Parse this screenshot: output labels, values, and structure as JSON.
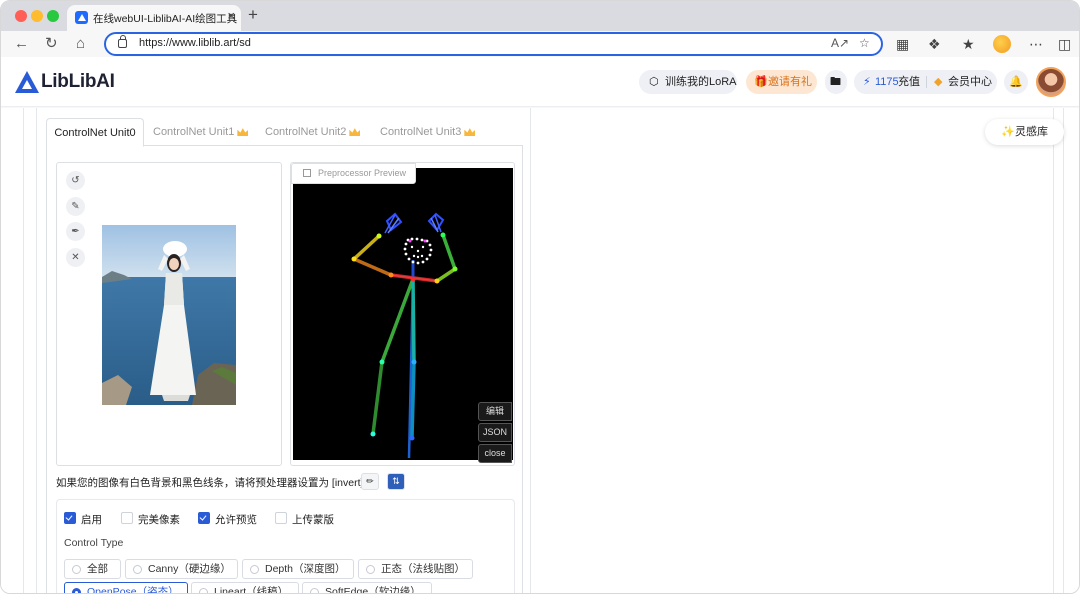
{
  "browser": {
    "tab_title": "在线webUI-LiblibAI-AI绘图工具",
    "tab_close": "×",
    "new_tab": "+",
    "url": "https://www.liblib.art/sd"
  },
  "header": {
    "logo_text": "LibLibAI",
    "train_lora": "训练我的LoRA",
    "invite": "邀请有礼",
    "credits_value": "1175",
    "recharge": "充值",
    "member_center": "会员中心"
  },
  "inspire": {
    "label": "灵感库"
  },
  "controlnet": {
    "tabs": [
      {
        "label": "ControlNet Unit0",
        "active": true,
        "premium": false
      },
      {
        "label": "ControlNet Unit1",
        "active": false,
        "premium": true
      },
      {
        "label": "ControlNet Unit2",
        "active": false,
        "premium": true
      },
      {
        "label": "ControlNet Unit3",
        "active": false,
        "premium": true
      }
    ],
    "preview_label": "Preprocessor Preview",
    "preview_buttons": {
      "edit": "编辑",
      "json": "JSON",
      "close": "close"
    },
    "invert_note": "如果您的图像有白色背景和黑色线条，请将预处理器设置为 [invert].",
    "options": [
      {
        "label": "启用",
        "checked": true
      },
      {
        "label": "完美像素",
        "checked": false
      },
      {
        "label": "允许预览",
        "checked": true
      },
      {
        "label": "上传蒙版",
        "checked": false
      }
    ],
    "control_type_label": "Control Type",
    "control_types_row1": [
      {
        "label": "全部",
        "selected": false
      },
      {
        "label": "Canny（硬边缘）",
        "selected": false
      },
      {
        "label": "Depth（深度图）",
        "selected": false
      },
      {
        "label": "正态（法线贴图）",
        "selected": false
      }
    ],
    "control_types_row2": [
      {
        "label": "OpenPose（姿态）",
        "selected": true
      },
      {
        "label": "Lineart（线稿）",
        "selected": false
      },
      {
        "label": "SoftEdge（软边缘）",
        "selected": false
      }
    ]
  },
  "colors": {
    "brand_blue": "#2a5bd7",
    "invite_orange": "#d9731b",
    "premium_gold": "#f6b73c"
  }
}
